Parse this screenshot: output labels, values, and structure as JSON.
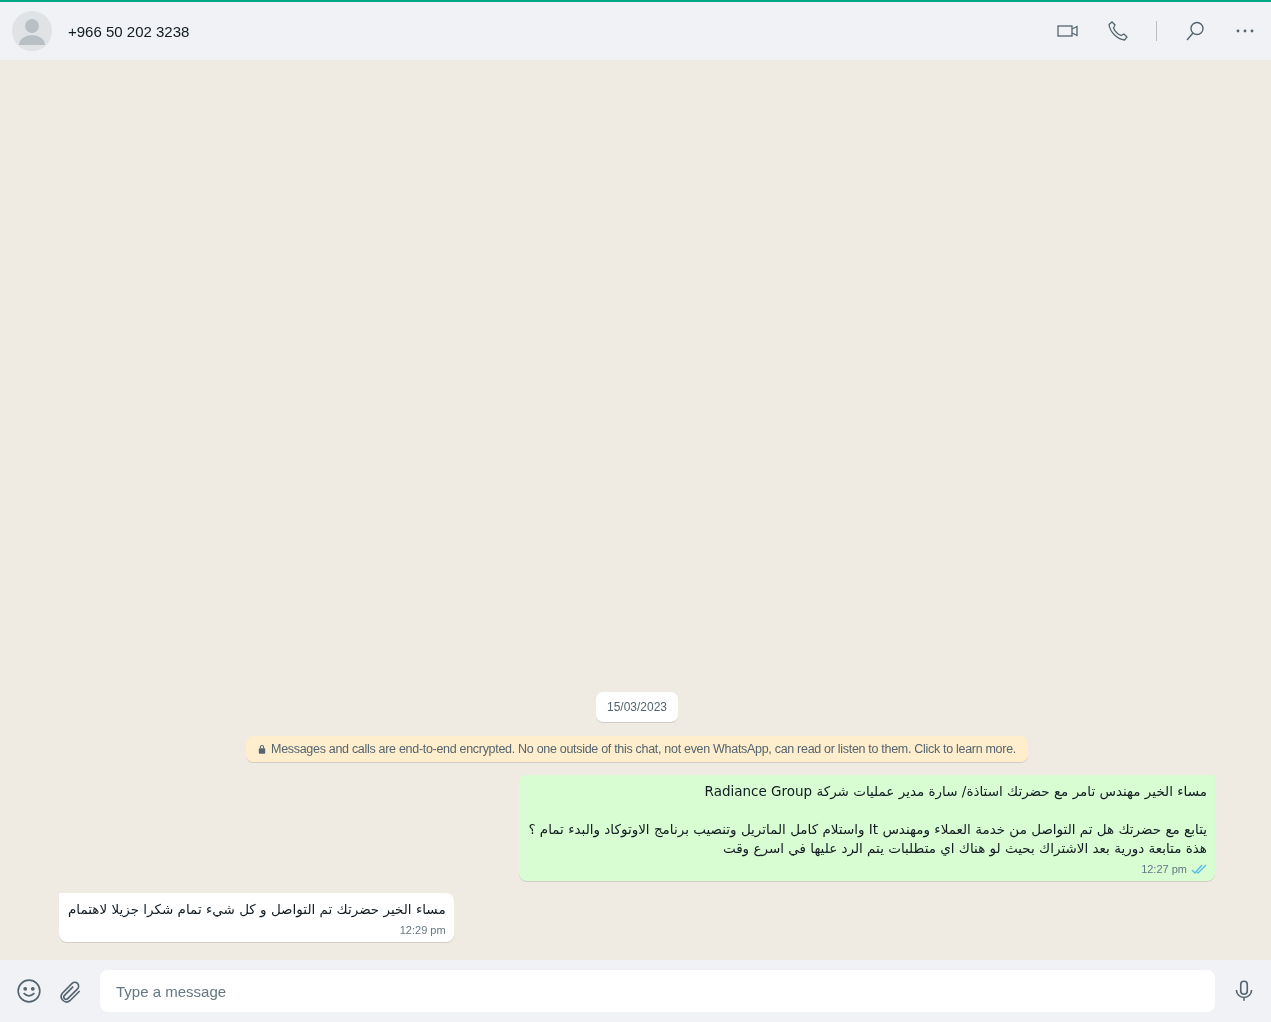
{
  "header": {
    "contact": "+966 50 202 3238"
  },
  "chat": {
    "date": "15/03/2023",
    "notice": "Messages and calls are end-to-end encrypted. No one outside of this chat, not even WhatsApp, can read or listen to them. Click to learn more.",
    "messages": [
      {
        "kind": "outgoing",
        "paragraphs": [
          "مساء الخير مهندس تامر مع حضرتك استاذة/ سارة مدير عمليات شركة Radiance Group",
          "يتابع مع حضرتك هل تم التواصل من خدمة العملاء ومهندس It واستلام كامل الماتريل وتنصيب برنامج الاوتوكاد والبدء تمام ؟\nهذة متابعة دورية بعد الاشتراك بحيث لو هناك اي متطلبات يتم الرد عليها في اسرع وقت"
        ],
        "time": "12:27 pm",
        "read": true
      },
      {
        "kind": "incoming",
        "paragraphs": [
          "مساء الخير حضرتك تم التواصل و كل شيء تمام شكرا جزيلا لاهتمام"
        ],
        "time": "12:29 pm",
        "read": false
      }
    ]
  },
  "composer": {
    "placeholder": "Type a message"
  }
}
